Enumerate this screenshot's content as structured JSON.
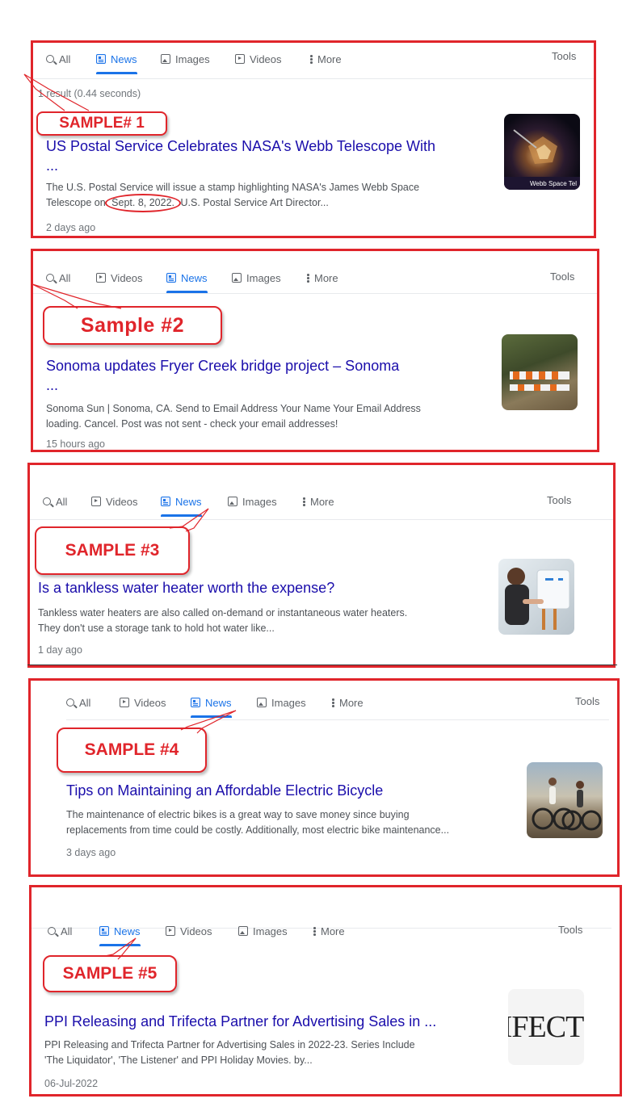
{
  "labels": {
    "all": "All",
    "news": "News",
    "images": "Images",
    "videos": "Videos",
    "more": "More",
    "tools": "Tools"
  },
  "samples": [
    {
      "callout": "SAMPLE# 1",
      "result_stats": "1 result (0.44 seconds)",
      "title_line1": "US Postal Service Celebrates NASA's Webb Telescope With",
      "title_line2": "...",
      "snippet_line1": "The U.S. Postal Service will issue a stamp highlighting NASA's James Webb Space",
      "snippet_pre": "Telescope on",
      "snippet_date": "Sept. 8, 2022.",
      "snippet_post": "U.S. Postal Service Art Director...",
      "age": "2 days ago",
      "thumb_caption": "Webb Space Tel"
    },
    {
      "callout": "Sample #2",
      "title_line1": "Sonoma updates Fryer Creek bridge project – Sonoma",
      "title_line2": "...",
      "snippet_line1": "Sonoma Sun | Sonoma, CA. Send to Email Address Your Name Your Email Address",
      "snippet_line2": "loading. Cancel. Post was not sent - check your email addresses!",
      "age": "15 hours ago"
    },
    {
      "callout": "SAMPLE #3",
      "title_line1": "Is a tankless water heater worth the expense?",
      "snippet_line1": "Tankless water heaters are also called on-demand or instantaneous water heaters.",
      "snippet_line2": "They don't use a storage tank to hold hot water like...",
      "age": "1 day ago"
    },
    {
      "callout": "SAMPLE #4",
      "title_line1": "Tips on Maintaining an Affordable Electric Bicycle",
      "snippet_line1": "The maintenance of electric bikes is a great way to save money since buying",
      "snippet_line2": "replacements from time could be costly. Additionally, most electric bike maintenance...",
      "age": "3 days ago"
    },
    {
      "callout": "SAMPLE #5",
      "title_line1": "PPI Releasing and Trifecta Partner for Advertising Sales in ...",
      "snippet_line1": "PPI Releasing and Trifecta Partner for Advertising Sales in 2022-23. Series Include",
      "snippet_line2": "'The Liquidator', 'The Listener' and PPI Holiday Movies. by...",
      "age": "06-Jul-2022",
      "thumb_caption": "IFECT"
    }
  ],
  "colors": {
    "annotation_red": "#e0252b",
    "link_blue": "#1a0dab",
    "active_tab_blue": "#1a73e8"
  }
}
